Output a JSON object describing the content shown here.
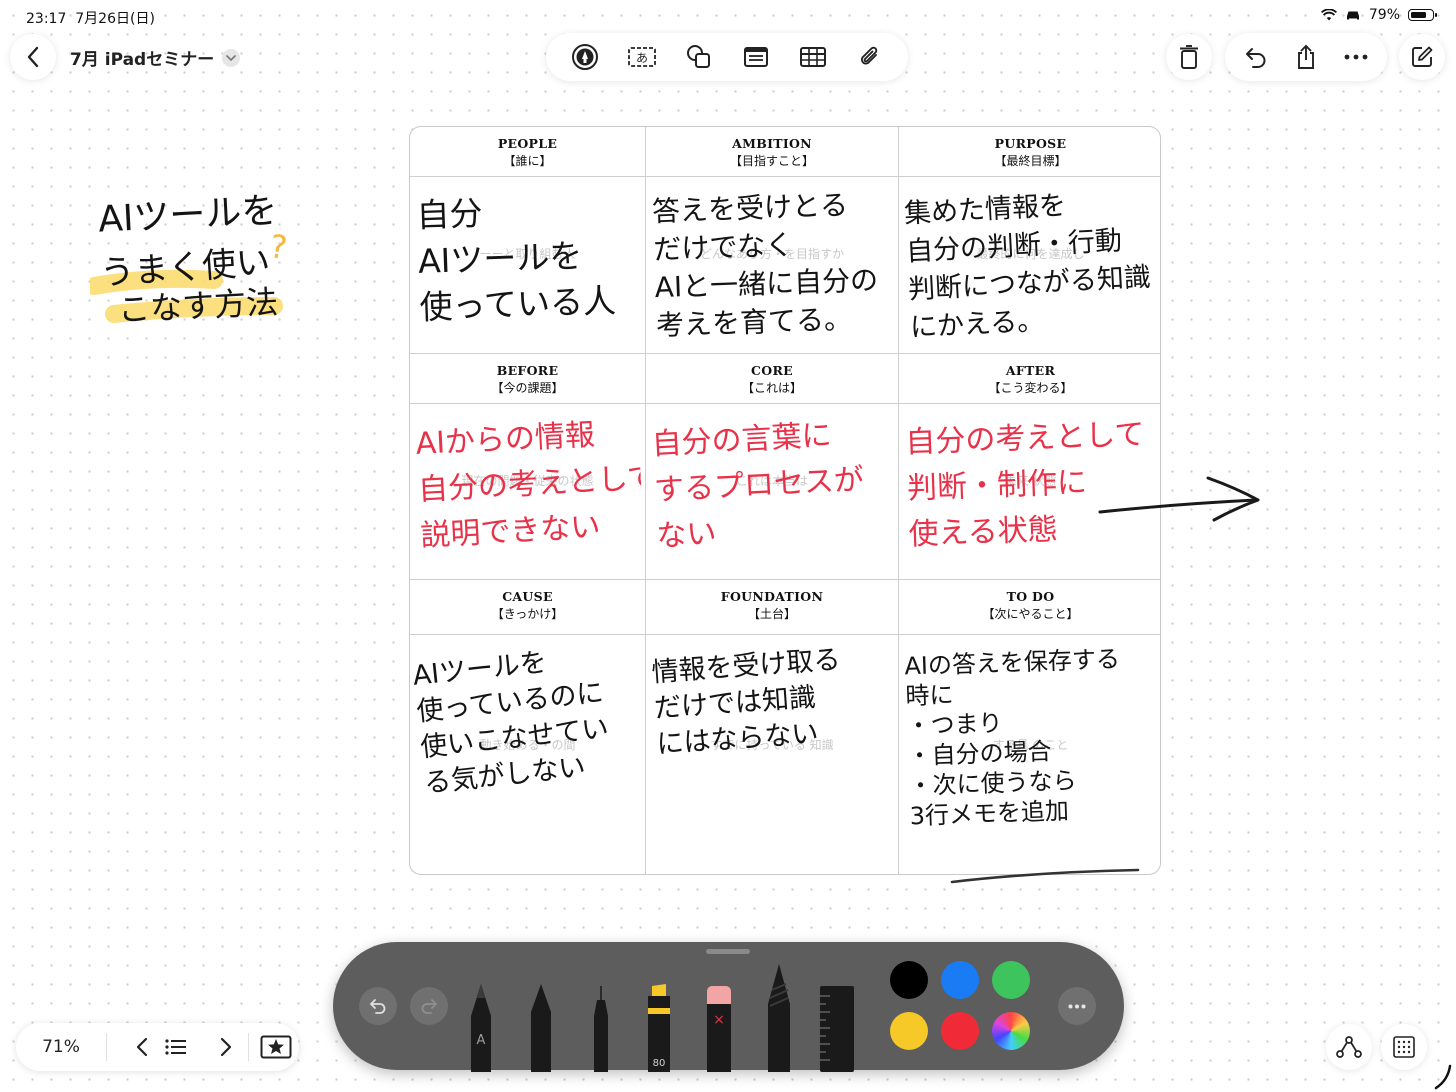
{
  "status": {
    "time": "23:17",
    "date": "7月26日(日)",
    "battery": "79%",
    "battery_level": 0.79
  },
  "header": {
    "back_label": "‹",
    "title": "7月 iPadセミナー"
  },
  "toolbar": {
    "tools": [
      "pen-in-circle-icon",
      "text-box-icon",
      "shapes-icon",
      "media-icon",
      "table-icon",
      "attachment-icon"
    ]
  },
  "right_toolbar": {
    "icons": [
      "trash-icon",
      "undo-icon",
      "share-icon",
      "more-icon",
      "compose-icon"
    ]
  },
  "note": {
    "line1": "AIツールを",
    "line2": "うまく使い",
    "line3": "こなす方法",
    "mark": "?"
  },
  "canvas": {
    "headers": [
      {
        "en": "PEOPLE",
        "ja": "【誰に】"
      },
      {
        "en": "AMBITION",
        "ja": "【目指すこと】"
      },
      {
        "en": "PURPOSE",
        "ja": "【最終目標】"
      },
      {
        "en": "BEFORE",
        "ja": "【今の課題】"
      },
      {
        "en": "CORE",
        "ja": "【これは】"
      },
      {
        "en": "AFTER",
        "ja": "【こう変わる】"
      },
      {
        "en": "CAUSE",
        "ja": "【きっかけ】"
      },
      {
        "en": "FOUNDATION",
        "ja": "【土台】"
      },
      {
        "en": "TO DO",
        "ja": "【次にやること】"
      }
    ],
    "ghost": [
      "ーーと取り組む人",
      "どんなあり方・を目指すか",
      "最終的に何を達成し",
      "現在の問題・従来の状態",
      "これは本当は",
      "未来 状態",
      "動き始める・の間",
      "すでに持っている 知識",
      "する具 のこと"
    ],
    "cells": [
      {
        "lines": [
          "自分",
          "AIツールを",
          "使っている人"
        ]
      },
      {
        "lines": [
          "答えを受けとる",
          "だけでなく",
          "AIと一緒に自分の",
          "考えを育てる。"
        ]
      },
      {
        "lines": [
          "集めた情報を",
          "自分の判断・行動",
          "判断につながる知識",
          "にかえる。"
        ]
      },
      {
        "lines": [
          "AIからの情報",
          "自分の考えとして",
          "説明できない"
        ]
      },
      {
        "lines": [
          "自分の言葉に",
          "するプロセスが",
          "ない"
        ]
      },
      {
        "lines": [
          "自分の考えとして",
          "判断・制作に",
          "使える状態"
        ]
      },
      {
        "lines": [
          "AIツールを",
          "使っているのに",
          "使いこなせてい",
          "る気がしない"
        ]
      },
      {
        "lines": [
          "情報を受け取る",
          "だけでは知識",
          "にはならない"
        ]
      },
      {
        "lines": [
          "AIの答えを保存する",
          "時に",
          "・つまり",
          "・自分の場合",
          "・次に使うなら",
          "3行メモを追加"
        ]
      }
    ],
    "arrow": "→"
  },
  "dock": {
    "undo": "↶",
    "redo": "↷",
    "tools": [
      "pencil-icon",
      "pen-icon",
      "fineliner-icon",
      "highlighter-icon",
      "eraser-icon",
      "crayon-icon",
      "ruler-icon"
    ],
    "highlighter_label": "80",
    "pencil_label": "A",
    "eraser_label": "×",
    "more": "•••",
    "colors": [
      "#000000",
      "#1a7cf5",
      "#3ec45c",
      "#f6c928",
      "#f02b37",
      "rainbow"
    ]
  },
  "bottom": {
    "zoom": "71%",
    "prev": "‹",
    "next": "›"
  }
}
